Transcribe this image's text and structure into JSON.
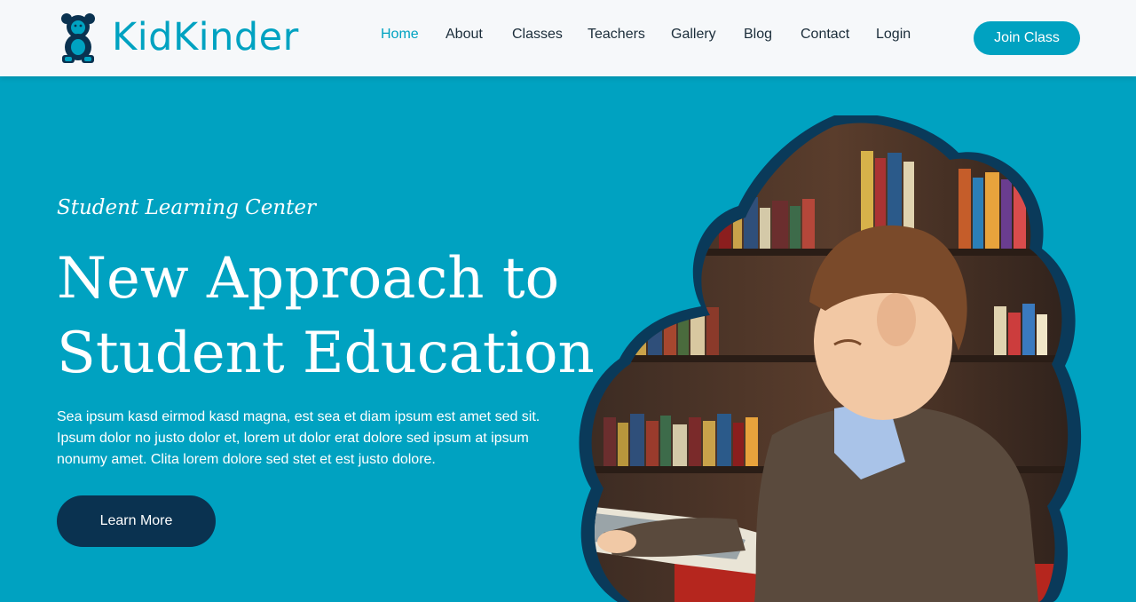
{
  "brand": {
    "name": "KidKinder",
    "icon": "teddy-bear-icon",
    "color": "#00A2C1"
  },
  "nav": {
    "items": [
      {
        "label": "Home",
        "active": true
      },
      {
        "label": "About",
        "active": false
      },
      {
        "label": "Classes",
        "active": false
      },
      {
        "label": "Teachers",
        "active": false
      },
      {
        "label": "Gallery",
        "active": false
      },
      {
        "label": "Blog",
        "active": false
      },
      {
        "label": "Contact",
        "active": false
      },
      {
        "label": "Login",
        "active": false
      }
    ],
    "cta_label": "Join Class"
  },
  "hero": {
    "subtitle": "Student Learning Center",
    "title_line1": "New Approach to",
    "title_line2": "Student Education",
    "text": "Sea ipsum kasd eirmod kasd magna, est sea et diam ipsum est amet sed sit. Ipsum dolor no justo dolor et, lorem ut dolor erat dolore sed ipsum at ipsum nonumy amet. Clita lorem dolore sed stet et est justo dolore.",
    "button_label": "Learn More",
    "image": "boy-reading-book-in-library"
  },
  "colors": {
    "primary": "#00A2C1",
    "dark": "#0A3250",
    "nav_bg": "#F6F8FA"
  }
}
